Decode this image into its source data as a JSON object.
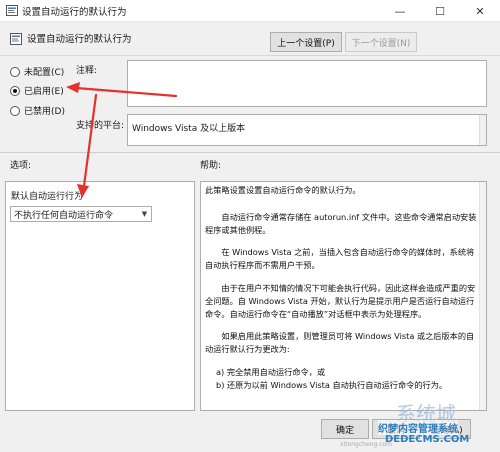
{
  "window": {
    "title": "设置自动运行的默认行为",
    "minimize": "—",
    "maximize": "☐",
    "close": "✕"
  },
  "header": {
    "title": "设置自动运行的默认行为",
    "prev_label": "上一个设置(P)",
    "next_label": "下一个设置(N)"
  },
  "radios": [
    {
      "label": "未配置(C)",
      "checked": false
    },
    {
      "label": "已启用(E)",
      "checked": true
    },
    {
      "label": "已禁用(D)",
      "checked": false
    }
  ],
  "comment": {
    "label": "注释:",
    "value": ""
  },
  "platform": {
    "label": "支持的平台:",
    "value": "Windows Vista 及以上版本"
  },
  "options": {
    "label": "选项:",
    "default_label": "默认自动运行行为",
    "dropdown_value": "不执行任何自动运行命令"
  },
  "help": {
    "label": "帮助:",
    "paragraphs": [
      "此策略设置设置自动运行命令的默认行为。",
      "自动运行命令通常存储在 autorun.inf 文件中。这些命令通常启动安装程序或其他例程。",
      "在 Windows Vista 之前，当插入包含自动运行命令的媒体时，系统将自动执行程序而不需用户干预。",
      "由于在用户不知情的情况下可能会执行代码，因此这样会造成严重的安全问题。自 Windows Vista 开始，默认行为是提示用户是否运行自动运行命令。自动运行命令在“自动播放”对话框中表示为处理程序。",
      "如果启用此策略设置，则管理员可将 Windows Vista 或之后版本的自动运行默认行为更改为:",
      "a) 完全禁用自动运行命令，或",
      "b) 还原为以前 Windows Vista 自动执行自动运行命令的行为。"
    ]
  },
  "footer": {
    "ok_label": "确定",
    "cancel_label": "取消",
    "apply_label": "应用(A)"
  },
  "watermark": {
    "logo": "系统城",
    "line1": "织梦内容管理系统",
    "line2": "DEDECMS.COM",
    "url": "xitongcheng.com"
  },
  "colors": {
    "annotation": "#e5312b",
    "accent": "#2a7fc0"
  }
}
